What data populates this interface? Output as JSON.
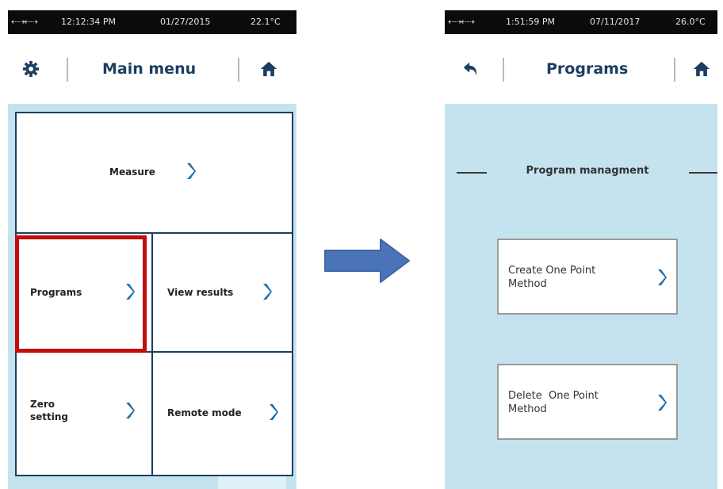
{
  "left_screen": {
    "status": {
      "time": "12:12:34 PM",
      "date": "01/27/2015",
      "temperature": "22.1°C"
    },
    "header": {
      "title": "Main menu",
      "left_icon": "gear-icon",
      "right_icon": "home-icon"
    },
    "tiles": {
      "measure": "Measure",
      "programs": "Programs",
      "view_results": "View results",
      "zero_setting": [
        "Zero",
        "setting"
      ],
      "remote_mode": "Remote mode"
    },
    "highlight_color": "#c30b0b"
  },
  "right_screen": {
    "status": {
      "time": "1:51:59 PM",
      "date": "07/11/2017",
      "temperature": "26.0°C"
    },
    "header": {
      "title": "Programs",
      "left_icon": "back-icon",
      "right_icon": "home-icon"
    },
    "section_title": "Program managment",
    "buttons": [
      {
        "lines": [
          "Create One Point",
          "Method"
        ]
      },
      {
        "lines": [
          "Delete  One Point",
          "Method"
        ]
      }
    ]
  },
  "colors": {
    "screen_bg": "#c5e3ef",
    "navy": "#1b3e62",
    "chevron": "#1f6fa8",
    "arrow": "#4a73b8"
  }
}
